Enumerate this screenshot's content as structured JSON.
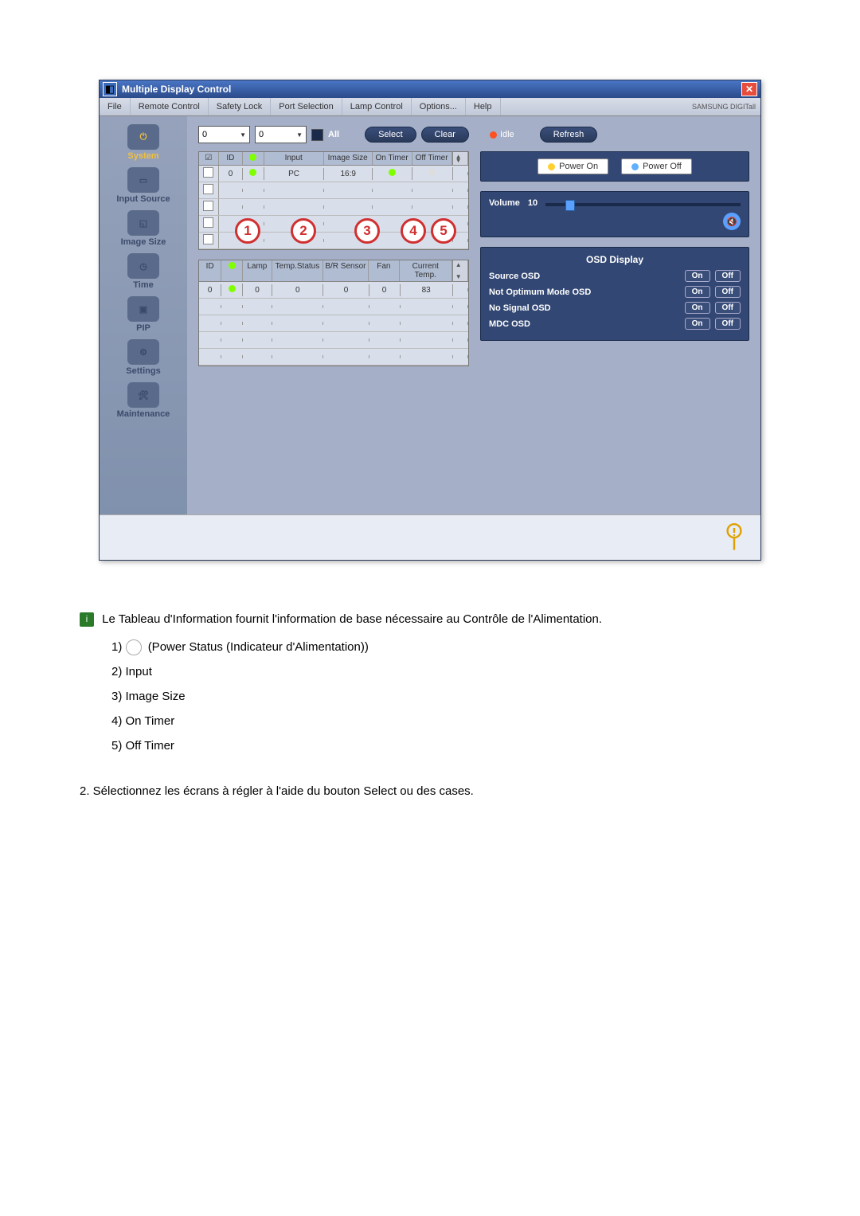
{
  "app": {
    "title": "Multiple Display Control",
    "brand": "SAMSUNG DIGITall"
  },
  "menubar": [
    "File",
    "Remote Control",
    "Safety Lock",
    "Port Selection",
    "Lamp Control",
    "Options...",
    "Help"
  ],
  "sidebar": [
    {
      "label": "System"
    },
    {
      "label": "Input Source"
    },
    {
      "label": "Image Size"
    },
    {
      "label": "Time"
    },
    {
      "label": "PIP"
    },
    {
      "label": "Settings"
    },
    {
      "label": "Maintenance"
    }
  ],
  "toprow": {
    "spin1": "0",
    "spin2": "0",
    "all_label": "All",
    "select": "Select",
    "clear": "Clear",
    "idle": "Idle",
    "refresh": "Refresh"
  },
  "power": {
    "on": "Power On",
    "off": "Power Off"
  },
  "volume": {
    "label": "Volume",
    "value": "10"
  },
  "osd": {
    "title": "OSD Display",
    "rows": [
      {
        "label": "Source OSD",
        "on": "On",
        "off": "Off"
      },
      {
        "label": "Not Optimum Mode OSD",
        "on": "On",
        "off": "Off"
      },
      {
        "label": "No Signal OSD",
        "on": "On",
        "off": "Off"
      },
      {
        "label": "MDC OSD",
        "on": "On",
        "off": "Off"
      }
    ]
  },
  "table1": {
    "headers": [
      "",
      "ID",
      "",
      "Input",
      "Image Size",
      "On Timer",
      "Off Timer"
    ],
    "row": {
      "id": "0",
      "input": "PC",
      "imgsize": "16:9"
    }
  },
  "table2": {
    "headers": [
      "ID",
      "",
      "Lamp",
      "Temp.Status",
      "B/R Sensor",
      "Fan",
      "Current Temp."
    ],
    "row": {
      "id": "0",
      "lamp": "0",
      "temp": "0",
      "br": "0",
      "fan": "0",
      "cur": "83"
    }
  },
  "callouts": [
    "1",
    "2",
    "3",
    "4",
    "5"
  ],
  "doc": {
    "intro": "Le Tableau d'Information fournit l'information de base nécessaire au Contrôle de l'Alimentation.",
    "items": [
      "(Power Status (Indicateur d'Alimentation))",
      "Input",
      "Image Size",
      "On Timer",
      "Off Timer"
    ],
    "note2": "2.  Sélectionnez les écrans à régler à l'aide du bouton Select ou des cases."
  }
}
